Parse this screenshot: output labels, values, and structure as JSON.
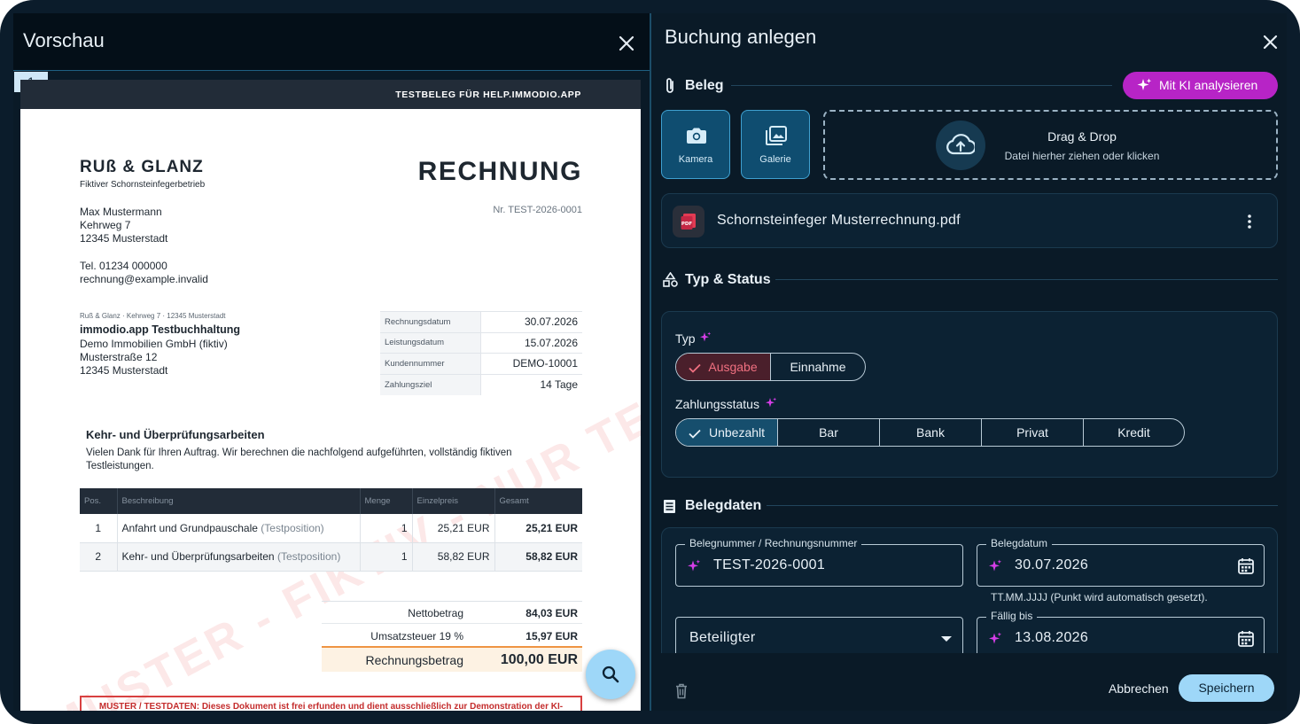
{
  "preview": {
    "title": "Vorschau",
    "page_tab": "1",
    "doc": {
      "banner": "TESTBELEG FÜR HELP.IMMODIO.APP",
      "company": "RUß & GLANZ",
      "company_sub": "Fiktiver Schornsteinfegerbetrieb",
      "doc_type": "RECHNUNG",
      "doc_number": "Nr. TEST-2026-0001",
      "sender": [
        "Max Mustermann",
        "Kehrweg 7",
        "12345 Musterstadt"
      ],
      "contact": [
        "Tel. 01234 000000",
        "rechnung@example.invalid"
      ],
      "return_line": "Ruß & Glanz · Kehrweg 7 · 12345 Musterstadt",
      "recipient_name": "immodio.app Testbuchhaltung",
      "recipient": [
        "Demo Immobilien GmbH (fiktiv)",
        "Musterstraße 12",
        "12345 Musterstadt"
      ],
      "info": [
        {
          "k": "Rechnungsdatum",
          "v": "30.07.2026"
        },
        {
          "k": "Leistungsdatum",
          "v": "15.07.2026"
        },
        {
          "k": "Kundennummer",
          "v": "DEMO-10001"
        },
        {
          "k": "Zahlungsziel",
          "v": "14 Tage"
        }
      ],
      "heading": "Kehr- und Überprüfungsarbeiten",
      "intro": "Vielen Dank für Ihren Auftrag. Wir berechnen die nachfolgend aufgeführten, vollständig fiktiven Testleistungen.",
      "table_headers": [
        "Pos.",
        "Beschreibung",
        "Menge",
        "Einzelpreis",
        "Gesamt"
      ],
      "rows": [
        {
          "pos": "1",
          "desc": "Anfahrt und Grundpauschale",
          "note": "(Testposition)",
          "qty": "1",
          "unit": "25,21 EUR",
          "total": "25,21 EUR"
        },
        {
          "pos": "2",
          "desc": "Kehr- und Überprüfungsarbeiten",
          "note": "(Testposition)",
          "qty": "1",
          "unit": "58,82 EUR",
          "total": "58,82 EUR"
        }
      ],
      "net_label": "Nettobetrag",
      "net_value": "84,03 EUR",
      "vat_label": "Umsatzsteuer 19 %",
      "vat_value": "15,97 EUR",
      "total_label": "Rechnungsbetrag",
      "total_value": "100,00 EUR",
      "watermark": "MUSTER - FIKTIV - NUR TESTDATEN",
      "disclaimer": "MUSTER / TESTDATEN: Dieses Dokument ist frei erfunden und dient ausschließlich zur Demonstration der KI-gestützten Buchhaltung in einem Hilfevideo für help.immodio.app. Es besteht keine Forderung."
    }
  },
  "form": {
    "title": "Buchung anlegen",
    "beleg": {
      "section": "Beleg",
      "ai_button": "Mit KI analysieren",
      "camera": "Kamera",
      "gallery": "Galerie",
      "drop_title": "Drag & Drop",
      "drop_sub": "Datei hierher ziehen oder klicken",
      "file_name": "Schornsteinfeger Musterrechnung.pdf",
      "file_badge": "PDF"
    },
    "typ_status": {
      "section": "Typ & Status",
      "typ_label": "Typ",
      "typ_options": [
        "Ausgabe",
        "Einnahme"
      ],
      "typ_selected": "Ausgabe",
      "zahlung_label": "Zahlungsstatus",
      "zahlung_options": [
        "Unbezahlt",
        "Bar",
        "Bank",
        "Privat",
        "Kredit"
      ],
      "zahlung_selected": "Unbezahlt"
    },
    "belegdaten": {
      "section": "Belegdaten",
      "belegnummer_label": "Belegnummer / Rechnungsnummer",
      "belegnummer_value": "TEST-2026-0001",
      "belegdatum_label": "Belegdatum",
      "belegdatum_value": "30.07.2026",
      "belegdatum_hint": "TT.MM.JJJJ (Punkt wird automatisch gesetzt).",
      "beteiligter_label": "Beteiligter",
      "faellig_label": "Fällig bis",
      "faellig_value": "13.08.2026"
    },
    "footer": {
      "cancel": "Abbrechen",
      "save": "Speichern"
    }
  },
  "colors": {
    "accent_ai": "#b724c6",
    "primary": "#9ed7f8",
    "expense_red": "#e05a6a",
    "background": "#0a1a27"
  }
}
